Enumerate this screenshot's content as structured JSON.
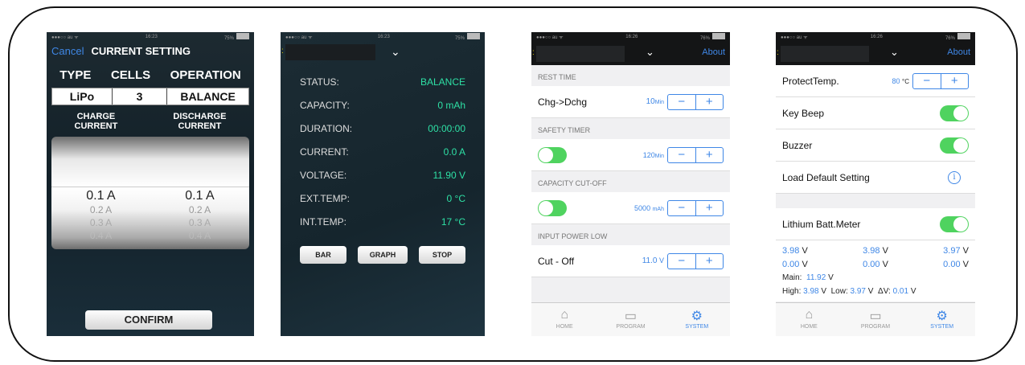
{
  "phone1": {
    "nav": {
      "cancel": "Cancel",
      "title": "CURRENT SETTING"
    },
    "headers": [
      "TYPE",
      "CELLS",
      "OPERATION"
    ],
    "values": [
      "LiPo",
      "3",
      "BALANCE"
    ],
    "current_labels": {
      "charge": "CHARGE\nCURRENT",
      "discharge": "DISCHARGE\nCURRENT"
    },
    "picker": {
      "charge": [
        "0.1 A",
        "0.2 A",
        "0.3 A",
        "0.4 A"
      ],
      "discharge": [
        "0.1 A",
        "0.2 A",
        "0.3 A",
        "0.4 A"
      ]
    },
    "confirm": "CONFIRM"
  },
  "phone2": {
    "rows": [
      {
        "key": "STATUS:",
        "value": "BALANCE"
      },
      {
        "key": "CAPACITY:",
        "value": "0 mAh"
      },
      {
        "key": "DURATION:",
        "value": "00:00:00"
      },
      {
        "key": "CURRENT:",
        "value": "0.0 A"
      },
      {
        "key": "VOLTAGE:",
        "value": "11.90 V"
      },
      {
        "key": "EXT.TEMP:",
        "value": "0 °C"
      },
      {
        "key": "INT.TEMP:",
        "value": "17 °C"
      }
    ],
    "buttons": [
      "BAR",
      "GRAPH",
      "STOP"
    ]
  },
  "phone3": {
    "about": "About",
    "sections": {
      "rest": "REST TIME",
      "safety": "SAFETY TIMER",
      "capacity": "CAPACITY CUT-OFF",
      "input": "INPUT POWER LOW"
    },
    "chg_dchg": {
      "label": "Chg->Dchg",
      "value": "10",
      "unit": "Min"
    },
    "safety_value": {
      "value": "120",
      "unit": "Min"
    },
    "capacity_value": {
      "value": "5000",
      "unit": "mAh"
    },
    "cutoff": {
      "label": "Cut - Off",
      "value": "11.0",
      "unit": "V"
    },
    "tabs": [
      "HOME",
      "PROGRAM",
      "SYSTEM"
    ]
  },
  "phone4": {
    "about": "About",
    "protect": {
      "label": "ProtectTemp.",
      "value": "80",
      "unit": "°C"
    },
    "key_beep": "Key Beep",
    "buzzer": "Buzzer",
    "load_default": "Load Default Setting",
    "lithium": "Lithium Batt.Meter",
    "cells_row1": [
      "3.98",
      "3.98",
      "3.97"
    ],
    "cells_row2": [
      "0.00",
      "0.00",
      "0.00"
    ],
    "unit_v": "V",
    "main": {
      "label": "Main:",
      "value": "11.92"
    },
    "high": {
      "label": "High:",
      "value": "3.98"
    },
    "low": {
      "label": "Low:",
      "value": "3.97"
    },
    "dv": {
      "label": "ΔV:",
      "value": "0.01"
    },
    "tabs": [
      "HOME",
      "PROGRAM",
      "SYSTEM"
    ]
  },
  "colors": {
    "accent": "#3f87e6",
    "toggle_on": "#4fd35f",
    "value_green": "#2ee0a5"
  },
  "icons": [
    "home-icon",
    "program-icon",
    "gear-icon",
    "chevron-down-icon",
    "info-icon"
  ]
}
